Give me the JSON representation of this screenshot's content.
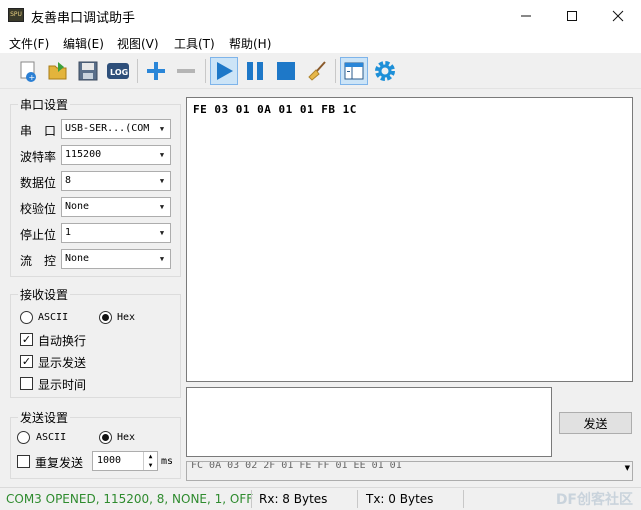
{
  "window": {
    "title": "友善串口调试助手",
    "app_icon_text": "SPU"
  },
  "menu": [
    {
      "label": "文件(F)"
    },
    {
      "label": "编辑(E)"
    },
    {
      "label": "视图(V)"
    },
    {
      "label": "工具(T)"
    },
    {
      "label": "帮助(H)"
    }
  ],
  "toolbar": {
    "icons": [
      "new-icon",
      "open-icon",
      "save-icon",
      "log-icon",
      "add-icon",
      "remove-icon",
      "play-icon",
      "pause-icon",
      "stop-icon",
      "clear-icon",
      "layout-icon",
      "settings-icon"
    ],
    "log_text": "LOG"
  },
  "serial_settings": {
    "title": "串口设置",
    "rows": [
      {
        "label": "串　口",
        "value": "USB-SER...(COM"
      },
      {
        "label": "波特率",
        "value": "115200"
      },
      {
        "label": "数据位",
        "value": "8"
      },
      {
        "label": "校验位",
        "value": "None"
      },
      {
        "label": "停止位",
        "value": "1"
      },
      {
        "label": "流　控",
        "value": "None"
      }
    ]
  },
  "receive_settings": {
    "title": "接收设置",
    "ascii": "ASCII",
    "hex": "Hex",
    "auto_wrap": "自动换行",
    "show_send": "显示发送",
    "show_time": "显示时间"
  },
  "send_settings": {
    "title": "发送设置",
    "ascii": "ASCII",
    "hex": "Hex",
    "repeat": "重复发送",
    "interval": "1000",
    "unit": "ms"
  },
  "receive_text": "FE 03 01 0A 01 01 FB 1C",
  "send_button": "发送",
  "history_text": "FC 0A 03 02 2F 01 FE FF 01 EE 01 01",
  "status": {
    "port": "COM3 OPENED, 115200, 8, NONE, 1, OFF",
    "rx": "Rx: 8 Bytes",
    "tx": "Tx: 0 Bytes",
    "watermark": "DF创客社区"
  },
  "colors": {
    "status_ok": "#2e8b2e",
    "accent_blue": "#1e78c8"
  }
}
